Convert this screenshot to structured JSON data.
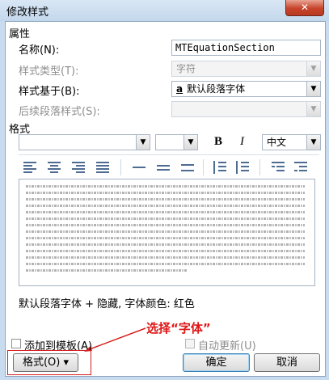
{
  "window": {
    "title": "修改样式",
    "close_label": "✕"
  },
  "properties": {
    "group_label": "属性",
    "name_label": "名称(N):",
    "name_value": "MTEquationSection",
    "style_type_label": "样式类型(T):",
    "style_type_value": "字符",
    "based_on_label": "样式基于(B):",
    "based_on_value": "默认段落字体",
    "based_on_icon": "a",
    "next_style_label": "后续段落样式(S):",
    "next_style_value": ""
  },
  "format": {
    "group_label": "格式",
    "font_value": "",
    "size_value": "",
    "bold_label": "B",
    "italic_label": "I",
    "language_value": "中文"
  },
  "description": "默认段落字体 + 隐藏, 字体颜色: 红色",
  "bottom": {
    "add_to_template_label": "添加到模板(A)",
    "auto_update_label": "自动更新(U)",
    "format_button_label": "格式(O) ▾",
    "ok_label": "确定",
    "cancel_label": "取消"
  },
  "annotation": {
    "text": "选择“字体”",
    "color": "#e01515"
  },
  "colors": {
    "accent": "#3c7fb1",
    "annotation": "#d62020",
    "title_bar": "#c9dcef"
  }
}
